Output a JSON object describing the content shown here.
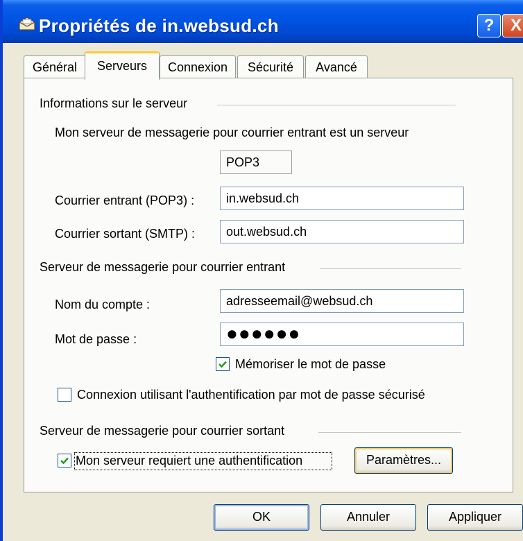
{
  "window": {
    "title": "Propriétés de in.websud.ch",
    "help_label": "?",
    "close_label": "X"
  },
  "tabs": [
    {
      "label": "Général"
    },
    {
      "label": "Serveurs"
    },
    {
      "label": "Connexion"
    },
    {
      "label": "Sécurité"
    },
    {
      "label": "Avancé"
    }
  ],
  "server_info": {
    "heading": "Informations sur le serveur",
    "description": "Mon serveur de messagerie pour courrier entrant est un serveur",
    "server_type": "POP3",
    "incoming_label": "Courrier entrant (POP3) :",
    "incoming_value": "in.websud.ch",
    "outgoing_label": "Courrier sortant (SMTP) :",
    "outgoing_value": "out.websud.ch"
  },
  "incoming": {
    "heading": "Serveur de messagerie pour courrier entrant",
    "account_label": "Nom du compte :",
    "account_value": "adresseemail@websud.ch",
    "password_label": "Mot de passe :",
    "password_value": "●●●●●●",
    "remember_label": "Mémoriser le mot de passe",
    "remember_checked": true,
    "spa_label": "Connexion utilisant l'authentification par mot de passe sécurisé",
    "spa_checked": false
  },
  "outgoing": {
    "heading": "Serveur de messagerie pour courrier sortant",
    "auth_label": "Mon serveur requiert une authentification",
    "auth_checked": true,
    "settings_label": "Paramètres..."
  },
  "footer": {
    "ok_label": "OK",
    "cancel_label": "Annuler",
    "apply_label": "Appliquer"
  }
}
